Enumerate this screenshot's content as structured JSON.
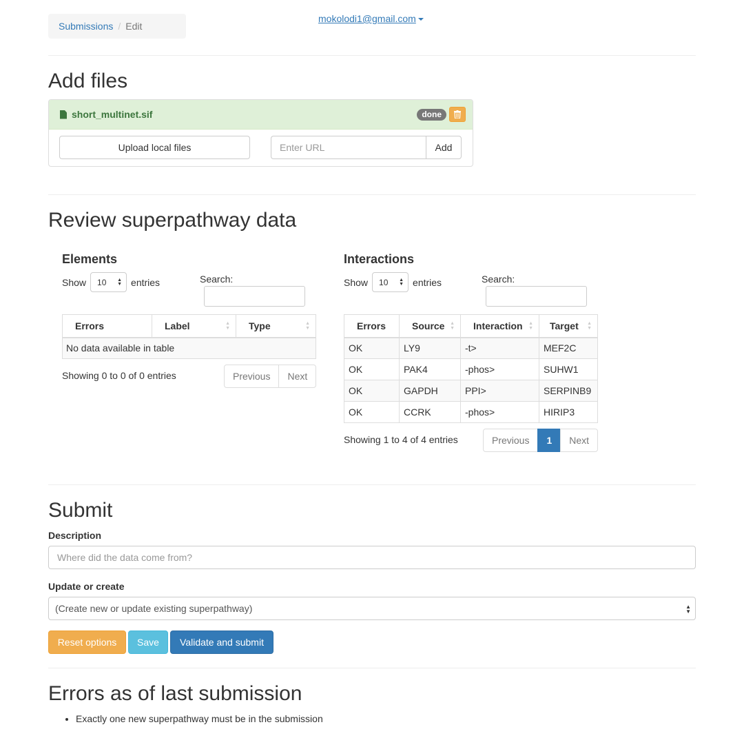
{
  "breadcrumb": {
    "link": "Submissions",
    "separator": "/",
    "current": "Edit"
  },
  "user": {
    "email": "mokolodi1@gmail.com"
  },
  "add_files": {
    "heading": "Add files",
    "file": {
      "name": "short_multinet.sif",
      "status": "done"
    },
    "upload_label": "Upload local files",
    "url_placeholder": "Enter URL",
    "add_label": "Add"
  },
  "review": {
    "heading": "Review superpathway data",
    "elements": {
      "title": "Elements",
      "show": "Show",
      "page_length": "10",
      "entries": "entries",
      "search_label": "Search:",
      "columns": [
        "Errors",
        "Label",
        "Type"
      ],
      "empty": "No data available in table",
      "info": "Showing 0 to 0 of 0 entries",
      "prev": "Previous",
      "next": "Next"
    },
    "interactions": {
      "title": "Interactions",
      "show": "Show",
      "page_length": "10",
      "entries": "entries",
      "search_label": "Search:",
      "columns": [
        "Errors",
        "Source",
        "Interaction",
        "Target"
      ],
      "rows": [
        [
          "OK",
          "LY9",
          "-t>",
          "MEF2C"
        ],
        [
          "OK",
          "PAK4",
          "-phos>",
          "SUHW1"
        ],
        [
          "OK",
          "GAPDH",
          "PPI>",
          "SERPINB9"
        ],
        [
          "OK",
          "CCRK",
          "-phos>",
          "HIRIP3"
        ]
      ],
      "info": "Showing 1 to 4 of 4 entries",
      "prev": "Previous",
      "page": "1",
      "next": "Next"
    }
  },
  "submit": {
    "heading": "Submit",
    "description_label": "Description",
    "description_placeholder": "Where did the data come from?",
    "update_label": "Update or create",
    "update_value": "(Create new or update existing superpathway)",
    "reset_label": "Reset options",
    "save_label": "Save",
    "validate_label": "Validate and submit"
  },
  "errors": {
    "heading": "Errors as of last submission",
    "items": [
      "Exactly one new superpathway must be in the submission"
    ]
  },
  "colors": {
    "primary": "#337ab7",
    "warning": "#f0ad4e",
    "info": "#5bc0de",
    "success_bg": "#dff0d8",
    "success_text": "#3c763d"
  }
}
